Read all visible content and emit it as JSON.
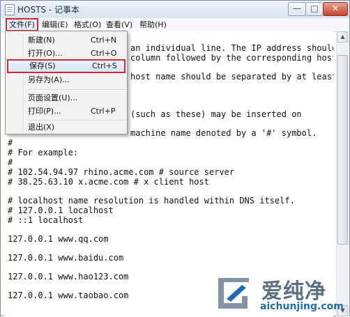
{
  "window": {
    "title": "HOSTS - 记事本",
    "minimize": "—",
    "maximize": "□",
    "close": "✕"
  },
  "menubar": {
    "items": [
      "文件(F)",
      "编辑(E)",
      "格式(O)",
      "查看(V)",
      "帮助(H)"
    ]
  },
  "file_menu": {
    "items": [
      {
        "label": "新建(N)",
        "shortcut": "Ctrl+N"
      },
      {
        "label": "打开(O)...",
        "shortcut": "Ctrl+O"
      },
      {
        "label": "保存(S)",
        "shortcut": "Ctrl+S"
      },
      {
        "label": "另存为(A)...",
        "shortcut": ""
      },
      {
        "label": "页面设置(U)...",
        "shortcut": ""
      },
      {
        "label": "打印(P)...",
        "shortcut": "Ctrl+P"
      },
      {
        "label": "退出(X)",
        "shortcut": ""
      }
    ]
  },
  "editor": {
    "lines": [
      "an individual line. The IP address should",
      "column followed by the corresponding host",
      "host name should be separated by at least",
      "(such as these) may be inserted on",
      "machine name denoted by a '#' symbol.",
      "#",
      "# For example:",
      "#",
      "# 102.54.94.97 rhino.acme.com # source server",
      "# 38.25.63.10 x.acme.com # x client host",
      "",
      "# localhost name resolution is handled within DNS itself.",
      "# 127.0.0.1 localhost",
      "# ::1 localhost",
      "",
      "127.0.0.1 www.qq.com",
      "127.0.0.1 www.baidu.com",
      "127.0.0.1 www.hao123.com",
      "127.0.0.1 www.taobao.com"
    ]
  },
  "scrollbar": {
    "up": "▲",
    "down": "▼"
  },
  "watermark": {
    "brand": "爱纯净",
    "url": "aichunjing.com"
  },
  "colors": {
    "highlight_border": "#d8262e",
    "menu_bg": "#f2f2f2",
    "text": "#111111"
  }
}
